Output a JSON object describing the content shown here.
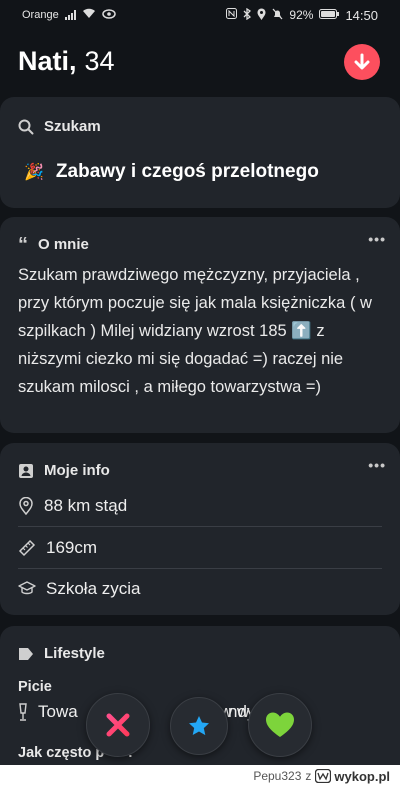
{
  "status_bar": {
    "carrier": "Orange",
    "battery": "92%",
    "time": "14:50"
  },
  "profile": {
    "name": "Nati,",
    "age": "34"
  },
  "looking_for": {
    "title": "Szukam",
    "emoji": "🎉",
    "value": "Zabawy i czegoś przelotnego"
  },
  "about": {
    "title": "O mnie",
    "text_part1": "Szukam prawdziwego mężczyzny, przyjaciela , przy którym poczuje się jak mala księżniczka ( w szpilkach ) Milej widziany wzrost 185 ",
    "emoji": "⬆️",
    "text_part2": " z niższymi ciezko mi się dogadać =) raczej nie szukam milosci , a miłego towarzystwa =)"
  },
  "my_info": {
    "title": "Moje info",
    "distance": "88 km stąd",
    "height": "169cm",
    "school": "Szkoła zycia"
  },
  "lifestyle": {
    "title": "Lifestyle",
    "drinking_label": "Picie",
    "drinking_value_visible_left": "Towa",
    "drinking_value_visible_mid": "w w",
    "drinking_value_visible_right": "ndy",
    "next_label_left": "Jak często p",
    "next_label_right": "?"
  },
  "actions": {
    "nope": "✕",
    "super_like": "★",
    "like": "💚"
  },
  "footer": {
    "user": "Pepu323",
    "z": "z",
    "site": "wykop.pl"
  }
}
